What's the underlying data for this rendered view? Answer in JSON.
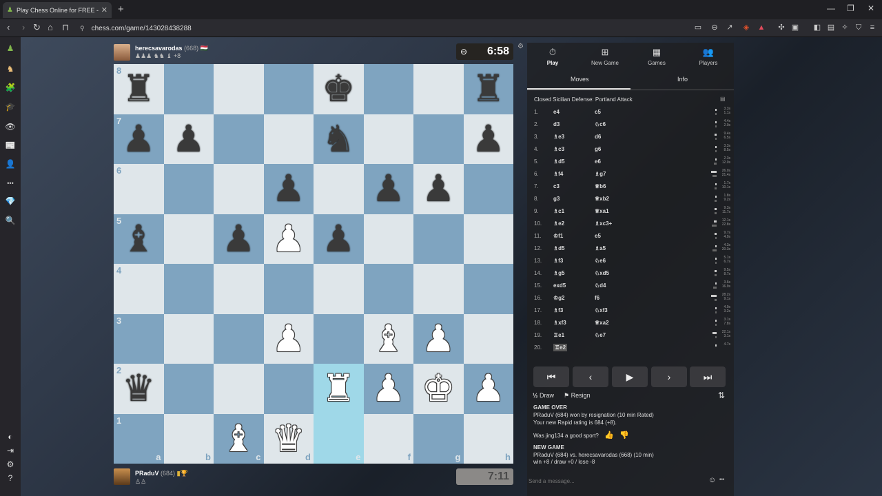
{
  "browser": {
    "tab_title": "Play Chess Online for FREE - ...",
    "tab_close": "✕",
    "new_tab": "+",
    "url": "chess.com/game/143028438288",
    "url_tune": "⚲"
  },
  "top_player": {
    "name": "herecsavarodas",
    "rating": "(668)",
    "flag": "🇭🇺",
    "captured": "♟♟♟ ♞♞ ♝ +8",
    "clock": "6:58",
    "clock_icon": "⊖"
  },
  "bottom_player": {
    "name": "PRaduV",
    "rating": "(684)",
    "captured": "♙♙",
    "clock": "7:11"
  },
  "board": {
    "files": [
      "a",
      "b",
      "c",
      "d",
      "e",
      "f",
      "g",
      "h"
    ],
    "ranks": [
      "8",
      "7",
      "6",
      "5",
      "4",
      "3",
      "2",
      "1"
    ],
    "highlight_squares": [
      "e2",
      "e1"
    ],
    "pieces": [
      {
        "sq": "a8",
        "glyph": "♜",
        "color": "black"
      },
      {
        "sq": "e8",
        "glyph": "♚",
        "color": "black"
      },
      {
        "sq": "h8",
        "glyph": "♜",
        "color": "black"
      },
      {
        "sq": "a7",
        "glyph": "♟",
        "color": "black"
      },
      {
        "sq": "b7",
        "glyph": "♟",
        "color": "black"
      },
      {
        "sq": "e7",
        "glyph": "♞",
        "color": "black"
      },
      {
        "sq": "h7",
        "glyph": "♟",
        "color": "black"
      },
      {
        "sq": "d6",
        "glyph": "♟",
        "color": "black"
      },
      {
        "sq": "f6",
        "glyph": "♟",
        "color": "black"
      },
      {
        "sq": "g6",
        "glyph": "♟",
        "color": "black"
      },
      {
        "sq": "a5",
        "glyph": "♝",
        "color": "black"
      },
      {
        "sq": "c5",
        "glyph": "♟",
        "color": "black"
      },
      {
        "sq": "d5",
        "glyph": "♟",
        "color": "white"
      },
      {
        "sq": "e5",
        "glyph": "♟",
        "color": "black"
      },
      {
        "sq": "d3",
        "glyph": "♟",
        "color": "white"
      },
      {
        "sq": "f3",
        "glyph": "♝",
        "color": "white"
      },
      {
        "sq": "g3",
        "glyph": "♟",
        "color": "white"
      },
      {
        "sq": "a2",
        "glyph": "♛",
        "color": "black"
      },
      {
        "sq": "e2",
        "glyph": "♜",
        "color": "white"
      },
      {
        "sq": "f2",
        "glyph": "♟",
        "color": "white"
      },
      {
        "sq": "g2",
        "glyph": "♚",
        "color": "white"
      },
      {
        "sq": "h2",
        "glyph": "♟",
        "color": "white"
      },
      {
        "sq": "c1",
        "glyph": "♝",
        "color": "white"
      },
      {
        "sq": "d1",
        "glyph": "♛",
        "color": "white"
      }
    ]
  },
  "panel": {
    "tabs": [
      {
        "icon": "⏱",
        "label": "Play"
      },
      {
        "icon": "⊞",
        "label": "New Game"
      },
      {
        "icon": "▦",
        "label": "Games"
      },
      {
        "icon": "👥",
        "label": "Players"
      }
    ],
    "subtabs": [
      "Moves",
      "Info"
    ],
    "opening": "Closed Sicilian Defense: Portland Attack",
    "moves": [
      {
        "n": "1.",
        "w": "e4",
        "b": "c5",
        "tw": "3.3s",
        "tb": "1.1s",
        "bw": 0.06,
        "bb": 0.02
      },
      {
        "n": "2.",
        "w": "d3",
        "b": "♘c6",
        "tw": "4.4s",
        "tb": "2.0s",
        "bw": 0.08,
        "bb": 0.04
      },
      {
        "n": "3.",
        "w": "♗e3",
        "b": "d6",
        "tw": "9.4s",
        "tb": "6.5s",
        "bw": 0.17,
        "bb": 0.12
      },
      {
        "n": "4.",
        "w": "♗c3",
        "b": "g6",
        "tw": "3.3s",
        "tb": "8.5s",
        "bw": 0.06,
        "bb": 0.15
      },
      {
        "n": "5.",
        "w": "♗d5",
        "b": "e6",
        "tw": "2.3s",
        "tb": "12.0s",
        "bw": 0.04,
        "bb": 0.22
      },
      {
        "n": "6.",
        "w": "♗f4",
        "b": "♗g7",
        "tw": "26.0s",
        "tb": "21.4s",
        "bw": 0.47,
        "bb": 0.39
      },
      {
        "n": "7.",
        "w": "c3",
        "b": "♕b6",
        "tw": "1.7s",
        "tb": "10.1s",
        "bw": 0.03,
        "bb": 0.18
      },
      {
        "n": "8.",
        "w": "g3",
        "b": "♕xb2",
        "tw": "1.8s",
        "tb": "9.2s",
        "bw": 0.03,
        "bb": 0.17
      },
      {
        "n": "9.",
        "w": "♗c1",
        "b": "♕xa1",
        "tw": "9.3s",
        "tb": "11.7s",
        "bw": 0.17,
        "bb": 0.21
      },
      {
        "n": "10.",
        "w": "♗e2",
        "b": "♗xc3+",
        "tw": "12.1s",
        "tb": "22.8s",
        "bw": 0.22,
        "bb": 0.41
      },
      {
        "n": "11.",
        "w": "♔f1",
        "b": "e5",
        "tw": "9.7s",
        "tb": "4.9s",
        "bw": 0.18,
        "bb": 0.09
      },
      {
        "n": "12.",
        "w": "♗d5",
        "b": "♗a5",
        "tw": "4.3s",
        "tb": "20.3s",
        "bw": 0.08,
        "bb": 0.37
      },
      {
        "n": "13.",
        "w": "♗f3",
        "b": "♘e6",
        "tw": "5.1s",
        "tb": "6.7s",
        "bw": 0.09,
        "bb": 0.12
      },
      {
        "n": "14.",
        "w": "♗g5",
        "b": "♘xd5",
        "tw": "9.5s",
        "tb": "8.7s",
        "bw": 0.17,
        "bb": 0.16
      },
      {
        "n": "15.",
        "w": "exd5",
        "b": "♘d4",
        "tw": "3.6s",
        "tb": "16.9s",
        "bw": 0.07,
        "bb": 0.31
      },
      {
        "n": "16.",
        "w": "♔g2",
        "b": "f6",
        "tw": "28.2s",
        "tb": "9.1s",
        "bw": 0.51,
        "bb": 0.17
      },
      {
        "n": "17.",
        "w": "♗f3",
        "b": "♘xf3",
        "tw": "4.9s",
        "tb": "3.2s",
        "bw": 0.09,
        "bb": 0.06
      },
      {
        "n": "18.",
        "w": "♗xf3",
        "b": "♕xa2",
        "tw": "3.1s",
        "tb": "7.8s",
        "bw": 0.06,
        "bb": 0.14
      },
      {
        "n": "19.",
        "w": "♖e1",
        "b": "♘e7",
        "tw": "22.1s",
        "tb": "3.1s",
        "bw": 0.4,
        "bb": 0.06
      },
      {
        "n": "20.",
        "w": "♖e2",
        "b": "",
        "tw": "4.7s",
        "tb": "",
        "bw": 0.09,
        "bb": 0
      }
    ],
    "controls": [
      "⏮",
      "‹",
      "▶",
      "›",
      "⏭"
    ],
    "draw_label": "Draw",
    "draw_icon": "½",
    "resign_label": "Resign",
    "resign_icon": "⚑",
    "flip_icon": "⇅",
    "game_over_title": "GAME OVER",
    "game_over_text": "PRaduV (684) won by resignation (10 min Rated)",
    "rating_text": "Your new Rapid rating is 684 (+8).",
    "good_sport": "Was jing134 a good sport?",
    "thumb_up": "👍",
    "thumb_down": "👎",
    "new_game_title": "NEW GAME",
    "new_game_text": "PRaduV (684) vs. herecsavarodas (668) (10 min)",
    "new_game_odds": "win +8 / draw +0 / lose -8",
    "message_placeholder": "Send a message...",
    "emoji_icon": "☺",
    "more_icon": "•••"
  },
  "rail": {
    "icons": [
      "♟",
      "♞",
      "🧩",
      "🎓",
      "👁",
      "📰",
      "👤",
      "•••",
      "💎",
      "🔍",
      "◐",
      "⇥",
      "⚙",
      "?"
    ]
  }
}
